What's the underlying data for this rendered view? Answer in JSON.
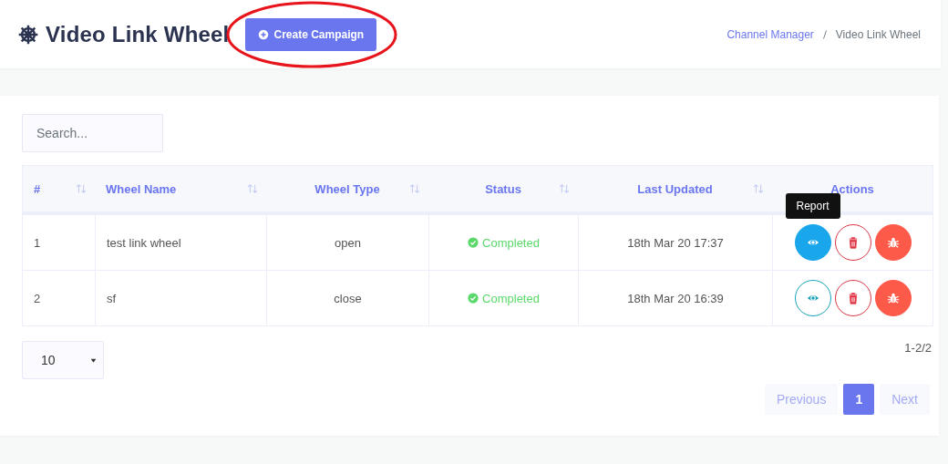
{
  "header": {
    "title": "Video Link Wheel",
    "create_button": "Create Campaign",
    "breadcrumb": [
      {
        "label": "Channel Manager",
        "kind": "link"
      },
      {
        "label": "Video Link Wheel",
        "kind": "current"
      }
    ]
  },
  "annotation": {
    "kind": "ellipse",
    "color": "#e8141c"
  },
  "search": {
    "placeholder": "Search..."
  },
  "table": {
    "columns": [
      {
        "label": "#",
        "sortable": true
      },
      {
        "label": "Wheel Name",
        "sortable": true
      },
      {
        "label": "Wheel Type",
        "sortable": true
      },
      {
        "label": "Status",
        "sortable": true
      },
      {
        "label": "Last Updated",
        "sortable": true
      },
      {
        "label": "Actions",
        "sortable": false
      }
    ],
    "rows": [
      {
        "index": "1",
        "name": "test link wheel",
        "type": "open",
        "status": "Completed",
        "updated": "18th Mar 20 17:37",
        "actions": [
          {
            "kind": "view",
            "hover": true,
            "tooltip": "Report"
          },
          {
            "kind": "delete"
          },
          {
            "kind": "debug"
          }
        ]
      },
      {
        "index": "2",
        "name": "sf",
        "type": "close",
        "status": "Completed",
        "updated": "18th Mar 20 16:39",
        "actions": [
          {
            "kind": "view",
            "hover": false
          },
          {
            "kind": "delete"
          },
          {
            "kind": "debug"
          }
        ]
      }
    ]
  },
  "page_size": "10",
  "range": "1-2/2",
  "pagination": [
    {
      "label": "Previous",
      "kind": "nav",
      "selected": false,
      "disabled": true
    },
    {
      "label": "1",
      "kind": "page",
      "selected": true,
      "disabled": false
    },
    {
      "label": "Next",
      "kind": "nav",
      "selected": false,
      "disabled": true
    }
  ]
}
